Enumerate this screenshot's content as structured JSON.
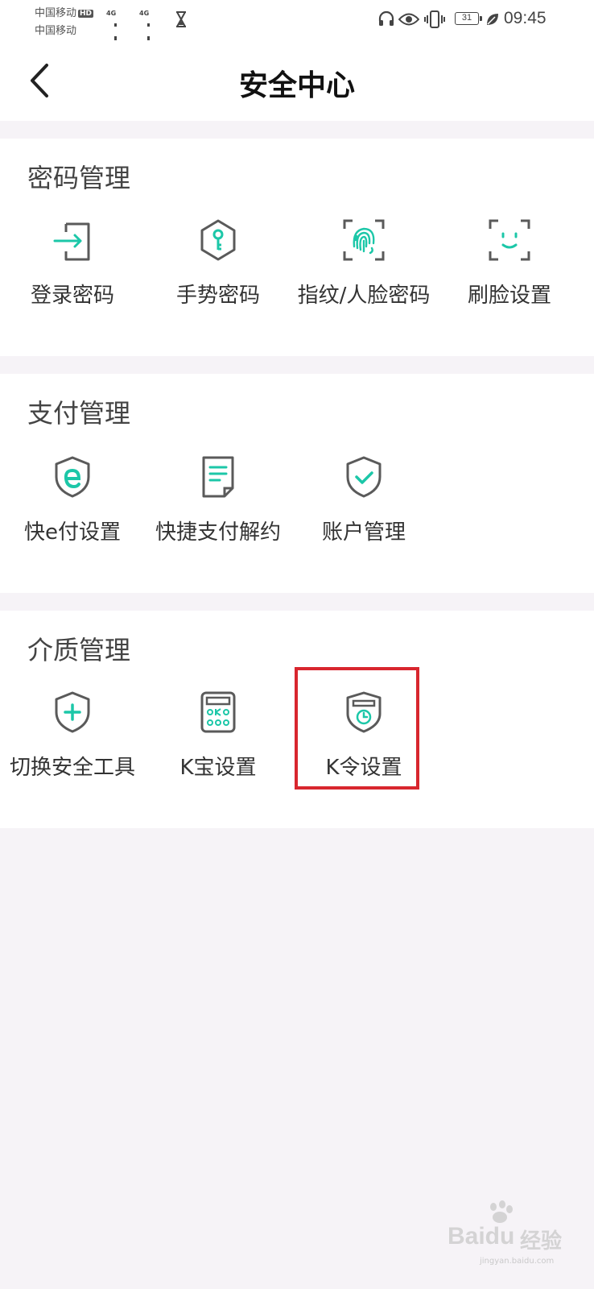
{
  "status_bar": {
    "carrier_1": "中国移动",
    "carrier_1_badge": "HD",
    "carrier_2": "中国移动",
    "network_1": "4G",
    "network_2": "4G",
    "battery": "31",
    "time": "09:45"
  },
  "header": {
    "title": "安全中心"
  },
  "sections": [
    {
      "title": "密码管理",
      "items": [
        {
          "label": "登录密码",
          "icon": "login-icon"
        },
        {
          "label": "手势密码",
          "icon": "gesture-key-icon"
        },
        {
          "label": "指纹/人脸密码",
          "icon": "fingerprint-icon"
        },
        {
          "label": "刷脸设置",
          "icon": "face-scan-icon"
        }
      ]
    },
    {
      "title": "支付管理",
      "items": [
        {
          "label": "快e付设置",
          "icon": "e-shield-icon"
        },
        {
          "label": "快捷支付解约",
          "icon": "document-icon"
        },
        {
          "label": "账户管理",
          "icon": "shield-check-icon"
        }
      ]
    },
    {
      "title": "介质管理",
      "items": [
        {
          "label": "切换安全工具",
          "icon": "shield-plus-icon"
        },
        {
          "label": "K宝设置",
          "icon": "ukey-calculator-icon"
        },
        {
          "label": "K令设置",
          "icon": "token-shield-icon"
        }
      ]
    }
  ],
  "watermark": {
    "brand": "Baidu",
    "brand_cn": "经验",
    "url": "jingyan.baidu.com"
  },
  "colors": {
    "accent": "#1cc7a8",
    "icon_outline": "#5a5a5a",
    "highlight": "#d8262e",
    "page_bg": "#f6f3f7"
  }
}
